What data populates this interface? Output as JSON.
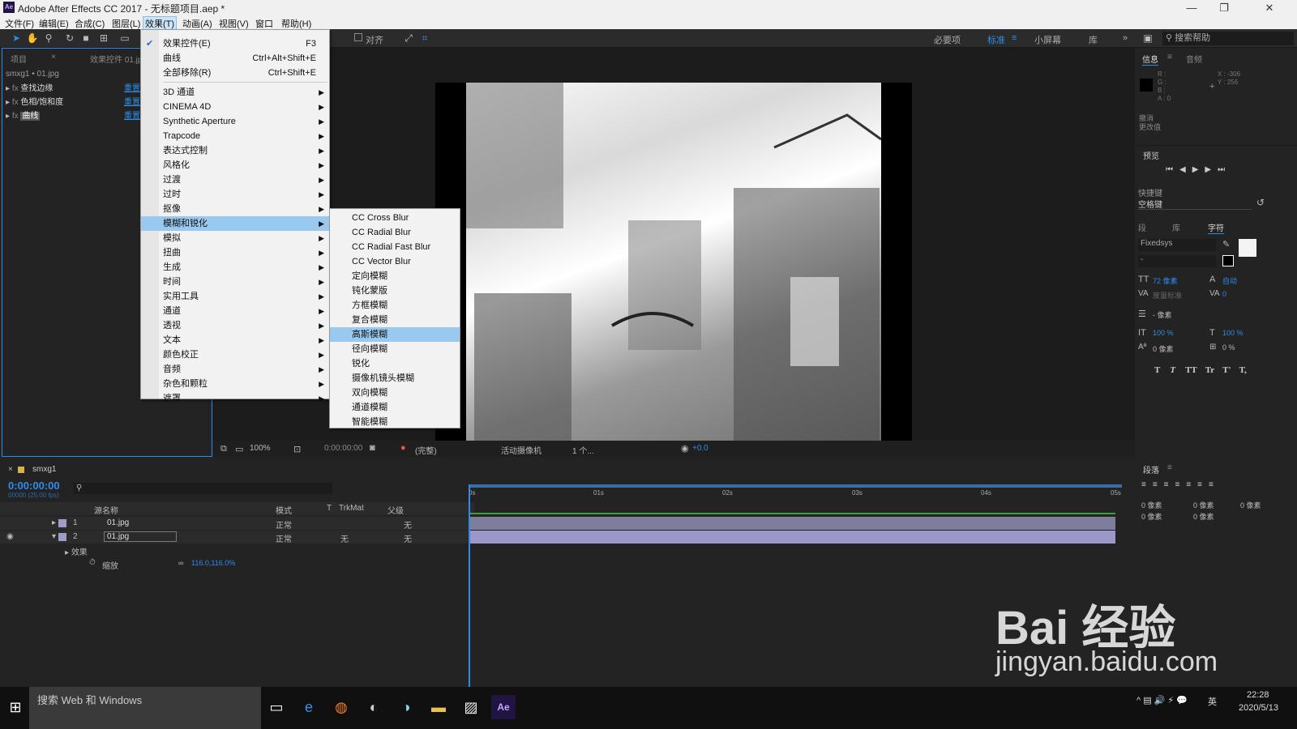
{
  "window": {
    "title": "Adobe After Effects CC 2017 - 无标题项目.aep *",
    "logo": "Ae",
    "controls": [
      "—",
      "❐",
      "✕"
    ]
  },
  "menubar": [
    "文件(F)",
    "编辑(E)",
    "合成(C)",
    "图层(L)",
    "效果(T)",
    "动画(A)",
    "视图(V)",
    "窗口",
    "帮助(H)"
  ],
  "toolbar": {
    "align": "对齐",
    "workspaces": [
      "必要项",
      "标准",
      "小屏幕",
      "库"
    ],
    "search": "搜索帮助"
  },
  "project": {
    "tab1": "项目",
    "tab2": "效果控件 01.jpg",
    "breadcrumb": "smxg1 • 01.jpg",
    "effects": [
      {
        "name": "查找边缘",
        "reset": "重置"
      },
      {
        "name": "色相/饱和度",
        "reset": "重置"
      },
      {
        "name": "曲线",
        "reset": "重置"
      }
    ]
  },
  "effect_menu": [
    {
      "label": "效果控件(E)",
      "shortcut": "F3",
      "checked": true
    },
    {
      "label": "曲线",
      "shortcut": "Ctrl+Alt+Shift+E"
    },
    {
      "label": "全部移除(R)",
      "shortcut": "Ctrl+Shift+E"
    },
    {
      "label": "3D 通道"
    },
    {
      "label": "CINEMA 4D"
    },
    {
      "label": "Synthetic Aperture"
    },
    {
      "label": "Trapcode"
    },
    {
      "label": "表达式控制"
    },
    {
      "label": "风格化"
    },
    {
      "label": "过渡"
    },
    {
      "label": "过时"
    },
    {
      "label": "抠像"
    },
    {
      "label": "模糊和锐化"
    },
    {
      "label": "模拟"
    },
    {
      "label": "扭曲"
    },
    {
      "label": "生成"
    },
    {
      "label": "时间"
    },
    {
      "label": "实用工具"
    },
    {
      "label": "通道"
    },
    {
      "label": "透视"
    },
    {
      "label": "文本"
    },
    {
      "label": "颜色校正"
    },
    {
      "label": "音频"
    },
    {
      "label": "杂色和颗粒"
    },
    {
      "label": "遮罩"
    }
  ],
  "blur_submenu": [
    "CC Cross Blur",
    "CC Radial Blur",
    "CC Radial Fast Blur",
    "CC Vector Blur",
    "定向模糊",
    "钝化蒙版",
    "方框模糊",
    "复合模糊",
    "高斯模糊",
    "径向模糊",
    "锐化",
    "摄像机镜头模糊",
    "双向模糊",
    "通道模糊",
    "智能模糊"
  ],
  "viewer_bar": {
    "zoom": "100%",
    "time": "0:00:00:00",
    "quality": "(完整)",
    "camera": "活动摄像机",
    "views": "1 个...",
    "exposure": "+0.0"
  },
  "info": {
    "tab": "信息",
    "tab2": "音频",
    "r": "R :",
    "g": "G :",
    "b": "B :",
    "a": "A : 0",
    "x": "X : -306",
    "y": "Y : 256",
    "undo": "撤消",
    "undo2": "更改值"
  },
  "preview": {
    "title": "预览",
    "shortcut_label": "快捷键",
    "shortcut": "空格键"
  },
  "character": {
    "tabs": [
      "段",
      "库",
      "字符"
    ],
    "font": "Fixedsys",
    "style": "-",
    "size": "72 像素",
    "leading": "自动",
    "tracking_label": "度量标准",
    "tracking": "0",
    "stroke": "- 像素",
    "scale_v": "100 %",
    "scale_h": "100 %",
    "baseline": "0 像素",
    "tsume": "0 %",
    "styles": [
      "T",
      "T",
      "TT",
      "Tr",
      "T'",
      "T,"
    ]
  },
  "paragraph": {
    "title": "段落",
    "indent": [
      "0 像素",
      "0 像素",
      "0 像素",
      "0 像素",
      "0 像素"
    ]
  },
  "timeline": {
    "comp": "smxg1",
    "time": "0:00:00:00",
    "fps": "00000 (25.00 fps)",
    "cols": [
      "源名称",
      "模式",
      "T",
      "TrkMat",
      "父级"
    ],
    "layers": [
      {
        "n": "1",
        "name": "01.jpg",
        "mode": "正常",
        "trk": "",
        "parent": "无"
      },
      {
        "n": "2",
        "name": "01.jpg",
        "mode": "正常",
        "trk": "无",
        "parent": "无"
      }
    ],
    "effects": "效果",
    "scale_label": "缩放",
    "scale": "116.0,116.0%",
    "ruler": [
      "0s",
      "01s",
      "02s",
      "03s",
      "04s",
      "05s"
    ]
  },
  "taskbar": {
    "search": "搜索 Web 和 Windows",
    "time": "22:28",
    "date": "2020/5/13",
    "ime": "英"
  },
  "watermark": {
    "logo": "Bai 经验",
    "url": "jingyan.baidu.com"
  }
}
